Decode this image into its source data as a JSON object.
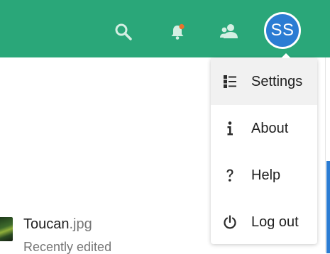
{
  "header": {
    "icons": [
      "search-icon",
      "notification-bell-icon",
      "contacts-icon"
    ],
    "notification_dot_color": "#e8722c",
    "background_color": "#2aa779",
    "avatar": {
      "initials": "SS",
      "color": "#2b7cd3"
    }
  },
  "menu": {
    "items": [
      {
        "label": "Settings",
        "icon": "settings-list-icon"
      },
      {
        "label": "About",
        "icon": "info-icon"
      },
      {
        "label": "Help",
        "icon": "help-icon"
      },
      {
        "label": "Log out",
        "icon": "power-icon"
      }
    ]
  },
  "file": {
    "name": "Toucan",
    "extension": ".jpg",
    "subtitle": "Recently edited"
  }
}
